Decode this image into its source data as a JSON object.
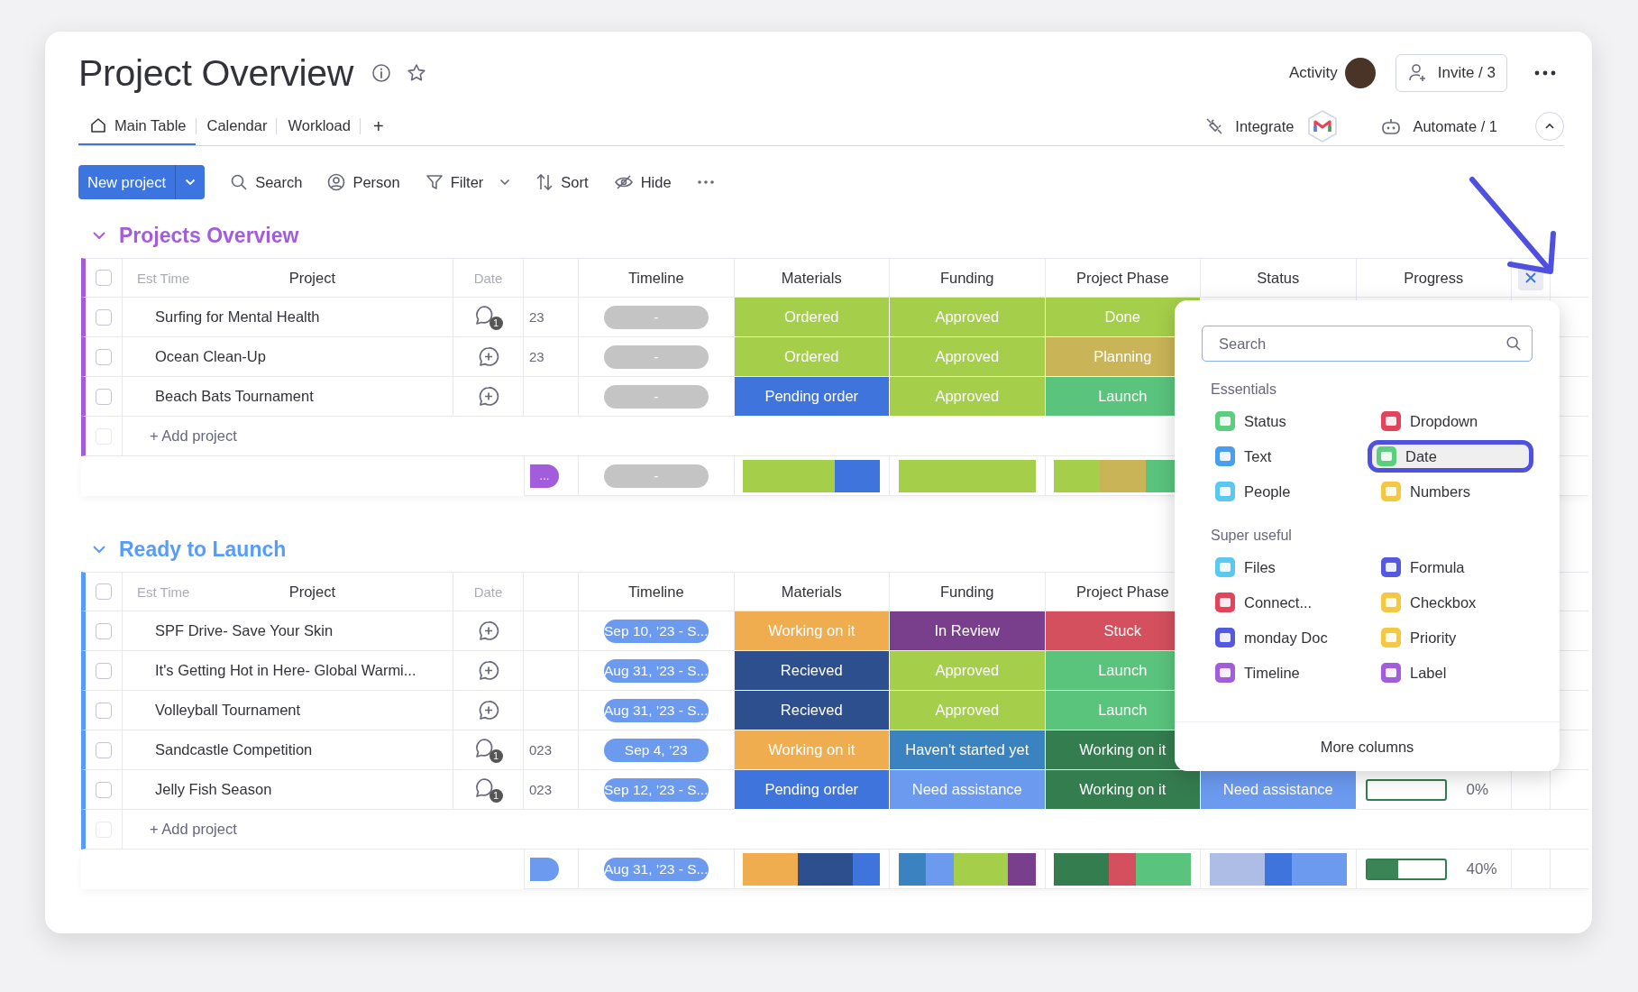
{
  "header": {
    "title": "Project Overview",
    "activity": "Activity",
    "invite": "Invite / 3"
  },
  "tabs": [
    {
      "label": "Main Table",
      "selected": true,
      "kind": "home"
    },
    {
      "label": "Calendar",
      "selected": false,
      "kind": "plain"
    },
    {
      "label": "Workload",
      "selected": false,
      "kind": "plain"
    }
  ],
  "add_tab": "+",
  "integrations": {
    "integrate": "Integrate",
    "automate": "Automate / 1"
  },
  "toolbar": {
    "new_button": "New project",
    "items": [
      {
        "kind": "search",
        "label": "Search",
        "dropdown": false
      },
      {
        "kind": "person",
        "label": "Person",
        "dropdown": false
      },
      {
        "kind": "filter",
        "label": "Filter",
        "dropdown": true
      },
      {
        "kind": "sort",
        "label": "Sort",
        "dropdown": false
      },
      {
        "kind": "hide",
        "label": "Hide",
        "dropdown": false
      }
    ]
  },
  "groups": [
    {
      "title": "Projects Overview",
      "color": "#a25ddc",
      "show_close": true,
      "header_checked": false,
      "ghost_columns": [
        "Est Time",
        "Date"
      ],
      "columns": [
        "Project",
        "Timeline",
        "Materials",
        "Funding",
        "Project Phase",
        "Status",
        "Progress"
      ],
      "rows": [
        {
          "name": "Surfing for Mental Health",
          "checked": false,
          "comments": "1",
          "date": "23",
          "timeline": {
            "text": "-",
            "color": "#c4c4c4"
          },
          "materials": {
            "text": "Ordered",
            "color": "#a5cf4a"
          },
          "funding": {
            "text": "Approved",
            "color": "#a5cf4a"
          },
          "phase": {
            "text": "Done",
            "color": "#a5cf4a"
          }
        },
        {
          "name": "Ocean Clean-Up",
          "checked": false,
          "date": "23",
          "timeline": {
            "text": "-",
            "color": "#c4c4c4"
          },
          "materials": {
            "text": "Ordered",
            "color": "#a5cf4a"
          },
          "funding": {
            "text": "Approved",
            "color": "#a5cf4a"
          },
          "phase": {
            "text": "Planning",
            "color": "#c9b458"
          }
        },
        {
          "name": "Beach Bats Tournament",
          "checked": false,
          "timeline": {
            "text": "-",
            "color": "#c4c4c4"
          },
          "materials": {
            "text": "Pending order",
            "color": "#3f74dd"
          },
          "funding": {
            "text": "Approved",
            "color": "#a5cf4a"
          },
          "phase": {
            "text": "Launch",
            "color": "#5ac47d"
          }
        }
      ],
      "add_label": "+ Add project",
      "summary": {
        "date_pill": {
          "text": "...",
          "color": "#a25ddc"
        },
        "timeline": {
          "text": "-",
          "color": "#c4c4c4"
        },
        "materials": [
          {
            "color": "#a5cf4a"
          },
          {
            "color": "#a5cf4a"
          },
          {
            "color": "#3f74dd"
          }
        ],
        "funding": [
          {
            "color": "#a5cf4a"
          },
          {
            "color": "#a5cf4a"
          },
          {
            "color": "#a5cf4a"
          }
        ],
        "phase": [
          {
            "color": "#a5cf4a"
          },
          {
            "color": "#c9b458"
          },
          {
            "color": "#5ac47d"
          }
        ]
      }
    },
    {
      "title": "Ready to Launch",
      "color": "#579bfc",
      "header_checked": false,
      "ghost_columns": [
        "Est Time",
        "Date"
      ],
      "columns": [
        "Project",
        "Timeline",
        "Materials",
        "Funding",
        "Project Phase"
      ],
      "rows": [
        {
          "name": "SPF Drive- Save Your Skin",
          "checked": false,
          "timeline": {
            "text": "Sep 10, ’23 - S...",
            "color": "#6b9aef"
          },
          "materials": {
            "text": "Working on it",
            "color": "#f0ad50"
          },
          "funding": {
            "text": "In Review",
            "color": "#7a3f8c"
          },
          "phase": {
            "text": "Stuck",
            "color": "#d4505e"
          }
        },
        {
          "name": "It's Getting Hot in Here- Global Warmi...",
          "checked": false,
          "timeline": {
            "text": "Aug 31, ’23 - S...",
            "color": "#6b9aef"
          },
          "materials": {
            "text": "Recieved",
            "color": "#2d4f8e"
          },
          "funding": {
            "text": "Approved",
            "color": "#a5cf4a"
          },
          "phase": {
            "text": "Launch",
            "color": "#5ac47d"
          }
        },
        {
          "name": "Volleyball Tournament",
          "checked": false,
          "timeline": {
            "text": "Aug 31, ’23 - S...",
            "color": "#6b9aef"
          },
          "materials": {
            "text": "Recieved",
            "color": "#2d4f8e"
          },
          "funding": {
            "text": "Approved",
            "color": "#a5cf4a"
          },
          "phase": {
            "text": "Launch",
            "color": "#5ac47d"
          }
        },
        {
          "name": "Sandcastle Competition",
          "checked": false,
          "comments": "1",
          "date": "023",
          "timeline": {
            "text": "Sep 4, ’23",
            "color": "#6b9aef"
          },
          "materials": {
            "text": "Working on it",
            "color": "#f0ad50"
          },
          "funding": {
            "text": "Haven't started yet",
            "color": "#3a83c0"
          },
          "phase": {
            "text": "Working on it",
            "color": "#347d4f"
          }
        },
        {
          "name": "Jelly Fish Season",
          "checked": false,
          "comments": "1",
          "date": "023",
          "timeline": {
            "text": "Sep 12, ’23 - S...",
            "color": "#6b9aef"
          },
          "materials": {
            "text": "Pending order",
            "color": "#3f74dd"
          },
          "funding": {
            "text": "Need assistance",
            "color": "#6b9aef"
          },
          "phase": {
            "text": "Working on it",
            "color": "#347d4f"
          },
          "status": {
            "text": "Need assistance",
            "color": "#6b9aef"
          },
          "progress": {
            "level": 0,
            "label": "0%"
          }
        }
      ],
      "add_label": "+ Add project",
      "summary": {
        "date_pill": {
          "color": "#6b9aef"
        },
        "timeline": {
          "text": "Aug 31, ’23 - S...",
          "color": "#6b9aef"
        },
        "materials": [
          {
            "color": "#f0ad50"
          },
          {
            "color": "#f0ad50"
          },
          {
            "color": "#2d4f8e"
          },
          {
            "color": "#2d4f8e"
          },
          {
            "color": "#3f74dd"
          }
        ],
        "funding": [
          {
            "color": "#3a83c0"
          },
          {
            "color": "#6b9aef"
          },
          {
            "color": "#a5cf4a"
          },
          {
            "color": "#a5cf4a"
          },
          {
            "color": "#7a3f8c"
          }
        ],
        "phase": [
          {
            "color": "#347d4f"
          },
          {
            "color": "#347d4f"
          },
          {
            "color": "#d4505e"
          },
          {
            "color": "#5ac47d"
          },
          {
            "color": "#5ac47d"
          }
        ],
        "status": [
          {
            "color": "#aebde6"
          },
          {
            "color": "#aebde6"
          },
          {
            "color": "#3f74dd"
          },
          {
            "color": "#6b9aef"
          },
          {
            "color": "#6b9aef"
          }
        ],
        "progress": {
          "level": 0.4,
          "label": "40%"
        }
      }
    }
  ],
  "column_menu": {
    "search_placeholder": "Search",
    "sections": [
      {
        "title": "Essentials",
        "items": [
          {
            "label": "Status",
            "color": "#5ccf7f",
            "selected": false
          },
          {
            "label": "Dropdown",
            "color": "#e2445c",
            "selected": false
          },
          {
            "label": "Text",
            "color": "#4a9ef0",
            "selected": false
          },
          {
            "label": "Date",
            "color": "#5ccf7f",
            "selected": true
          },
          {
            "label": "People",
            "color": "#5bc8f0",
            "selected": false
          },
          {
            "label": "Numbers",
            "color": "#f5c842",
            "selected": false
          }
        ]
      },
      {
        "title": "Super useful",
        "items": [
          {
            "label": "Files",
            "color": "#5bc8f0",
            "selected": false
          },
          {
            "label": "Formula",
            "color": "#5559df",
            "selected": false
          },
          {
            "label": "Connect...",
            "color": "#e2445c",
            "selected": false
          },
          {
            "label": "Checkbox",
            "color": "#f5c842",
            "selected": false
          },
          {
            "label": "monday Doc",
            "color": "#5559df",
            "selected": false
          },
          {
            "label": "Priority",
            "color": "#f5c842",
            "selected": false
          },
          {
            "label": "Timeline",
            "color": "#a25ddc",
            "selected": false
          },
          {
            "label": "Label",
            "color": "#a25ddc",
            "selected": false
          }
        ]
      }
    ],
    "more": "More columns"
  }
}
